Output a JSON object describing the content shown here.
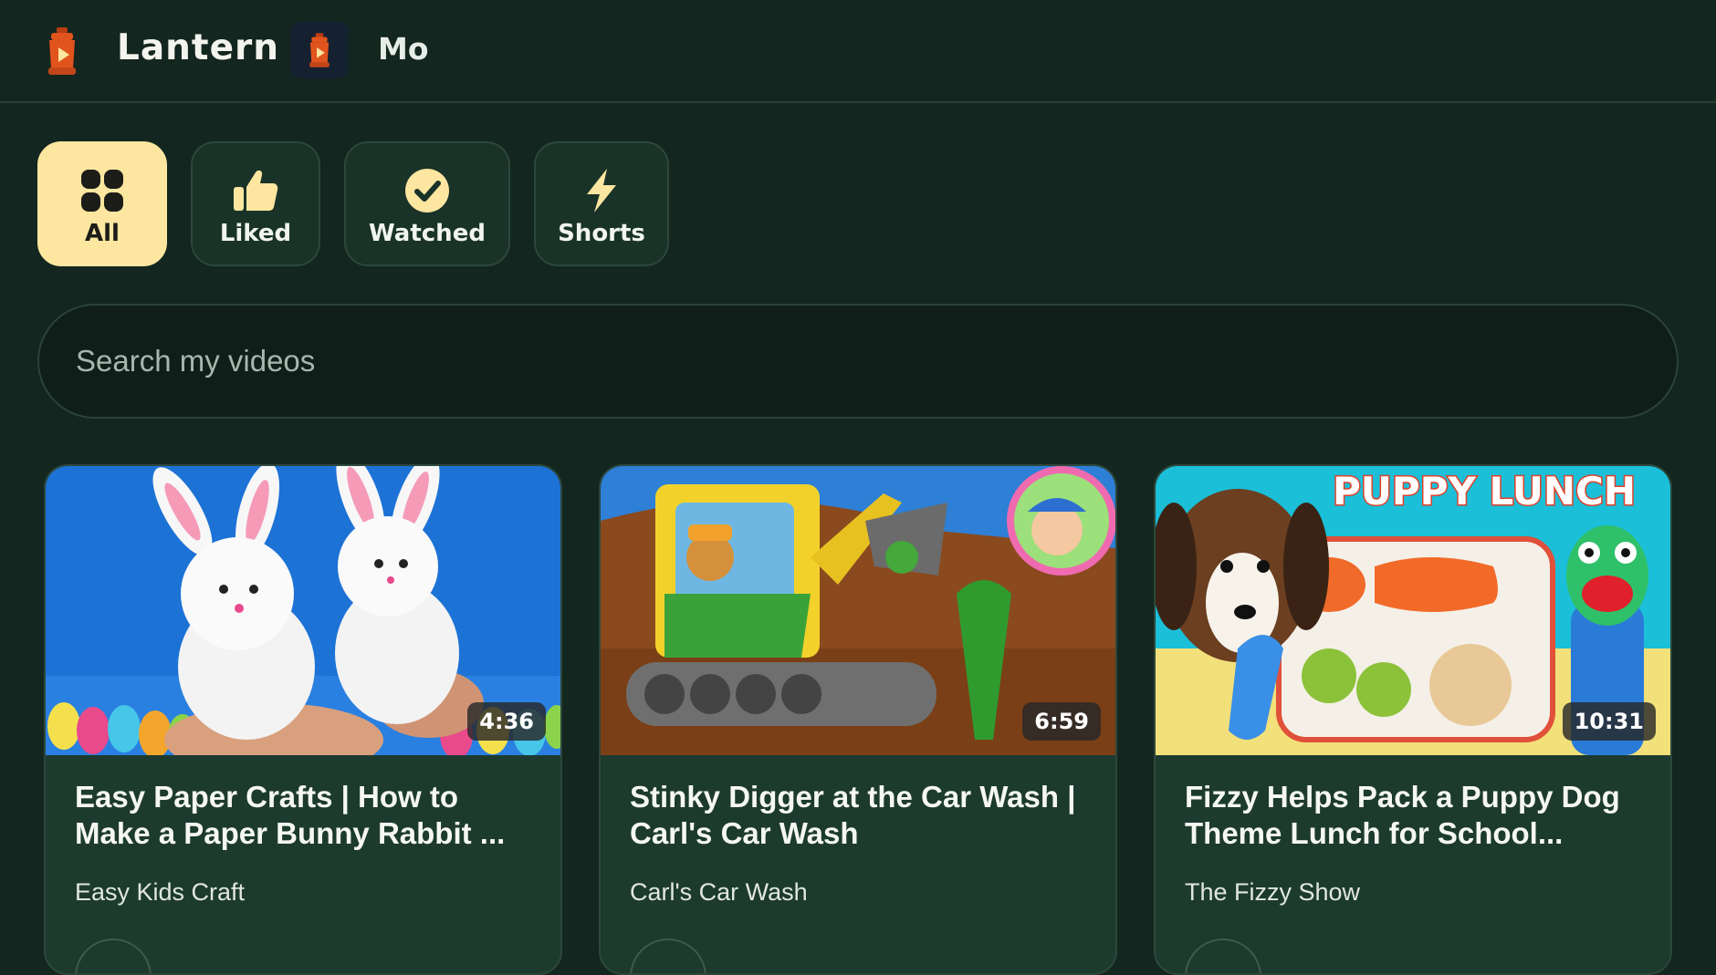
{
  "header": {
    "app_title": "Lantern",
    "profile_name": "Mo",
    "logo_icon": "lantern-icon",
    "accent": "#e2541d"
  },
  "tabs": [
    {
      "label": "All",
      "icon": "grid-icon",
      "active": true
    },
    {
      "label": "Liked",
      "icon": "thumbs-up-icon",
      "active": false
    },
    {
      "label": "Watched",
      "icon": "check-circle-icon",
      "active": false
    },
    {
      "label": "Shorts",
      "icon": "lightning-icon",
      "active": false
    }
  ],
  "search": {
    "placeholder": "Search my videos",
    "value": ""
  },
  "videos": [
    {
      "title": "Easy Paper Crafts | How to Make a Paper Bunny Rabbit ...",
      "channel": "Easy Kids Craft",
      "duration": "4:36"
    },
    {
      "title": "Stinky Digger at the Car Wash | Carl's Car Wash",
      "channel": "Carl's Car Wash",
      "duration": "6:59"
    },
    {
      "title": "Fizzy Helps Pack a Puppy Dog Theme Lunch for School...",
      "channel": "The Fizzy Show",
      "duration": "10:31",
      "thumbnail_text": "PUPPY LUNCH"
    }
  ],
  "colors": {
    "background": "#13261f",
    "card": "#1d3a2f",
    "tab_active": "#fde6a0"
  }
}
